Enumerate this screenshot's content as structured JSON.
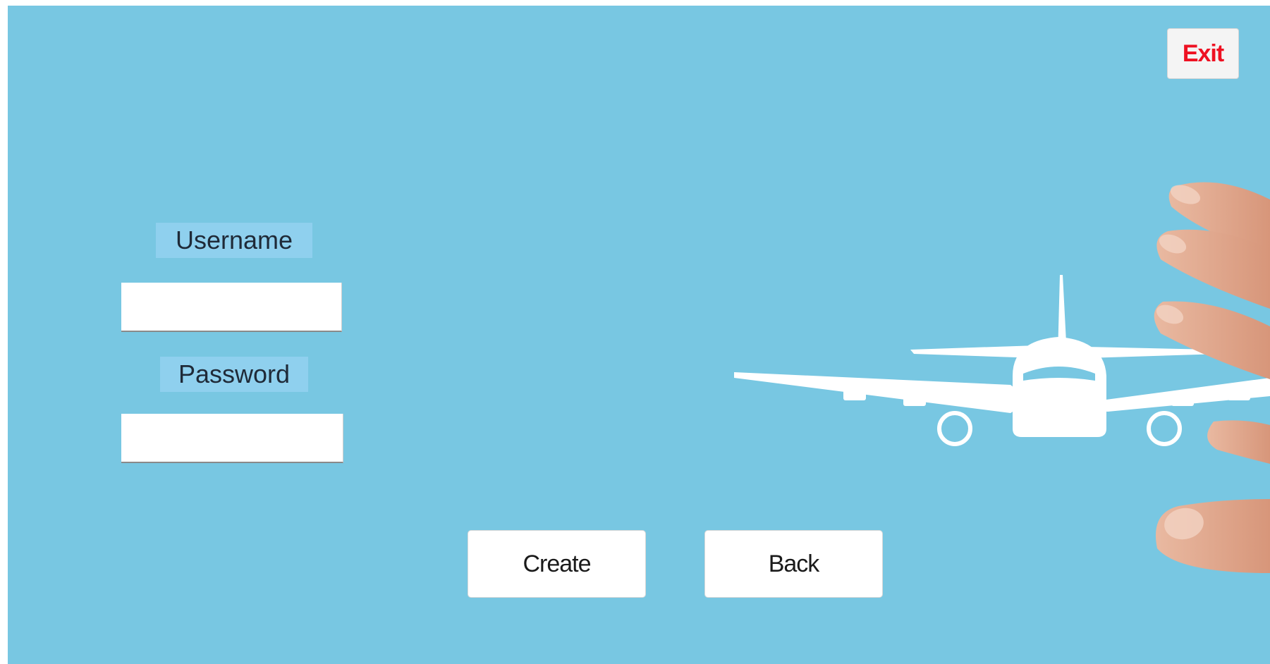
{
  "window": {
    "background_color": "#78c7e2"
  },
  "toolbar": {
    "exit_label": "Exit",
    "exit_color": "#ee1122"
  },
  "form": {
    "username_label": "Username",
    "username_value": "",
    "password_label": "Password",
    "password_value": ""
  },
  "actions": {
    "create_label": "Create",
    "back_label": "Back"
  },
  "decor": {
    "airplane_icon": "airplane-icon",
    "hand_image": "hand-image"
  }
}
